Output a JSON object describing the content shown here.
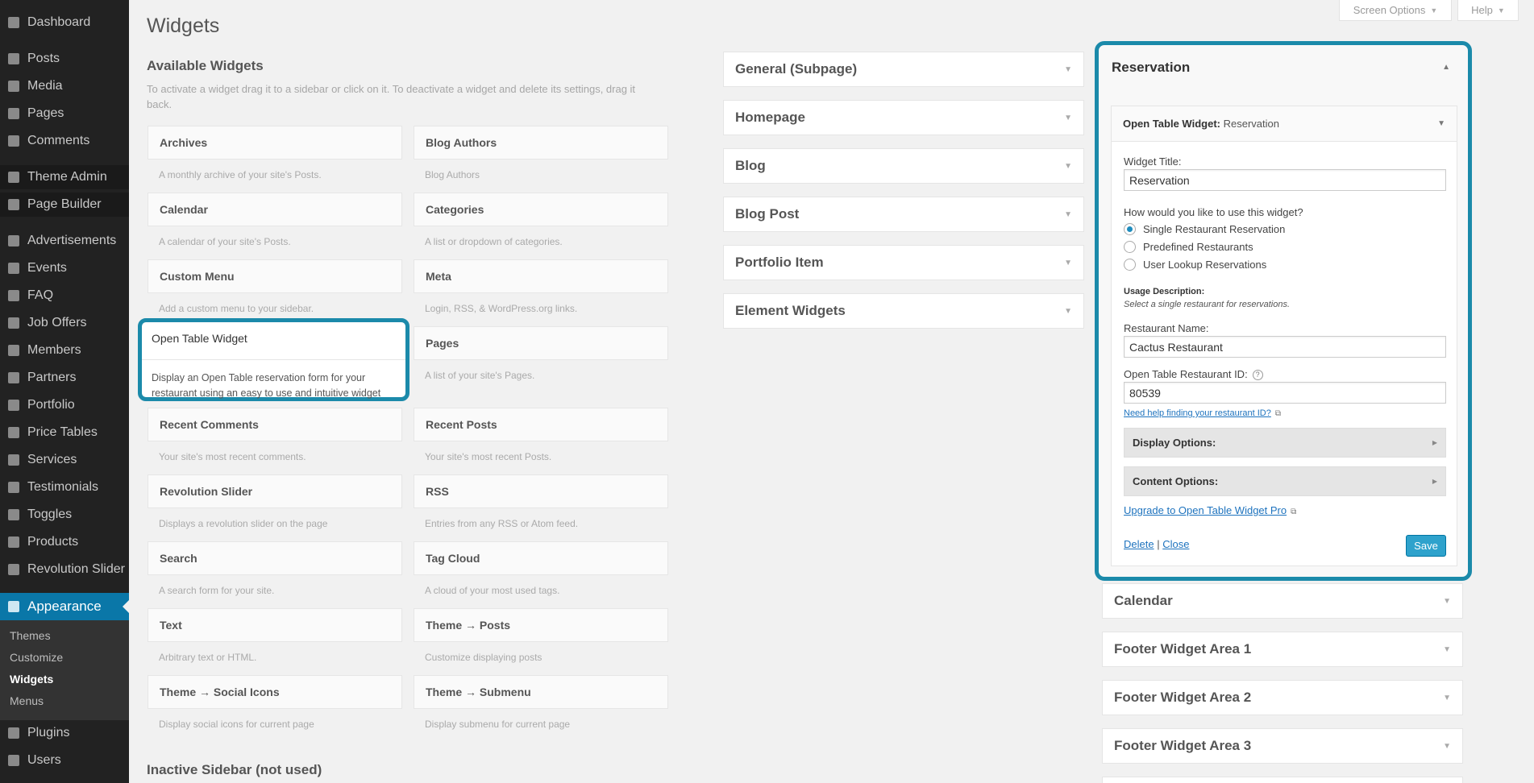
{
  "admin_menu": {
    "items": [
      {
        "label": "Dashboard",
        "icon": "dashboard-icon"
      },
      {
        "label": "Posts",
        "icon": "pin-icon"
      },
      {
        "label": "Media",
        "icon": "media-icon"
      },
      {
        "label": "Pages",
        "icon": "pages-icon"
      },
      {
        "label": "Comments",
        "icon": "comments-icon"
      },
      {
        "label": "Theme Admin",
        "icon": "theme-admin-icon"
      },
      {
        "label": "Page Builder",
        "icon": "page-builder-icon"
      },
      {
        "label": "Advertisements",
        "icon": "advertisements-icon"
      },
      {
        "label": "Events",
        "icon": "events-icon"
      },
      {
        "label": "FAQ",
        "icon": "faq-icon"
      },
      {
        "label": "Job Offers",
        "icon": "job-offers-icon"
      },
      {
        "label": "Members",
        "icon": "members-icon"
      },
      {
        "label": "Partners",
        "icon": "partners-icon"
      },
      {
        "label": "Portfolio",
        "icon": "portfolio-icon"
      },
      {
        "label": "Price Tables",
        "icon": "price-tables-icon"
      },
      {
        "label": "Services",
        "icon": "services-icon"
      },
      {
        "label": "Testimonials",
        "icon": "testimonials-icon"
      },
      {
        "label": "Toggles",
        "icon": "toggles-icon"
      },
      {
        "label": "Products",
        "icon": "products-icon"
      },
      {
        "label": "Revolution Slider",
        "icon": "revolution-slider-icon"
      }
    ],
    "current": {
      "label": "Appearance",
      "icon": "paintbrush-icon"
    },
    "submenu": [
      "Themes",
      "Customize",
      "Widgets",
      "Menus"
    ],
    "after": [
      {
        "label": "Plugins",
        "icon": "plugins-icon"
      },
      {
        "label": "Users",
        "icon": "users-icon"
      }
    ],
    "accent_color": "#0a77a8"
  },
  "screen_meta": {
    "screen_options": "Screen Options",
    "help": "Help"
  },
  "page": {
    "title": "Widgets",
    "available_heading": "Available Widgets",
    "intro": "To activate a widget drag it to a sidebar or click on it. To deactivate a widget and delete its settings, drag it back.",
    "inactive_heading": "Inactive Sidebar (not used)"
  },
  "widgets": [
    {
      "title": "Archives",
      "desc": "A monthly archive of your site's Posts."
    },
    {
      "title": "Blog Authors",
      "desc": "Blog Authors"
    },
    {
      "title": "Calendar",
      "desc": "A calendar of your site's Posts."
    },
    {
      "title": "Categories",
      "desc": "A list or dropdown of categories."
    },
    {
      "title": "Custom Menu",
      "desc": "Add a custom menu to your sidebar."
    },
    {
      "title": "Meta",
      "desc": "Login, RSS, & WordPress.org links."
    },
    {
      "title": "Open Table Widget",
      "desc": "Display an Open Table reservation form for your restaurant using an easy to use and intuitive widget"
    },
    {
      "title": "Pages",
      "desc": "A list of your site's Pages."
    },
    {
      "title": "Recent Comments",
      "desc": "Your site's most recent comments."
    },
    {
      "title": "Recent Posts",
      "desc": "Your site's most recent Posts."
    },
    {
      "title": "Revolution Slider",
      "desc": "Displays a revolution slider on the page"
    },
    {
      "title": "RSS",
      "desc": "Entries from any RSS or Atom feed."
    },
    {
      "title": "Search",
      "desc": "A search form for your site."
    },
    {
      "title": "Tag Cloud",
      "desc": "A cloud of your most used tags."
    },
    {
      "title": "Text",
      "desc": "Arbitrary text or HTML."
    },
    {
      "title": "Theme → Posts",
      "desc": "Customize displaying posts"
    },
    {
      "title": "Theme → Social Icons",
      "desc": "Display social icons for current page"
    },
    {
      "title": "Theme → Submenu",
      "desc": "Display submenu for current page"
    }
  ],
  "sidebars_left": [
    "General (Subpage)",
    "Homepage",
    "Blog",
    "Blog Post",
    "Portfolio Item",
    "Element Widgets"
  ],
  "sidebars_right": [
    "Calendar",
    "Footer Widget Area 1",
    "Footer Widget Area 2",
    "Footer Widget Area 3"
  ],
  "reservation": {
    "sidebar_title": "Reservation",
    "widget_name": "Open Table Widget:",
    "widget_instance": "Reservation",
    "widget_title_label": "Widget Title:",
    "widget_title_value": "Reservation",
    "usage_question": "How would you like to use this widget?",
    "options": [
      "Single Restaurant Reservation",
      "Predefined Restaurants",
      "User Lookup Reservations"
    ],
    "selected_option": "Single Restaurant Reservation",
    "usage_desc_label": "Usage Description:",
    "usage_desc": "Select a single restaurant for reservations.",
    "restaurant_name_label": "Restaurant Name:",
    "restaurant_name_value": "Cactus Restaurant",
    "restaurant_id_label": "Open Table Restaurant ID:",
    "restaurant_id_value": "80539",
    "help_link": "Need help finding your restaurant ID?",
    "display_options": "Display Options:",
    "content_options": "Content Options:",
    "upgrade_link": "Upgrade to Open Table Widget Pro",
    "delete": "Delete",
    "separator": "|",
    "close": "Close",
    "save": "Save",
    "highlight_color": "#1b8aaa",
    "save_color": "#2ea2cc"
  }
}
